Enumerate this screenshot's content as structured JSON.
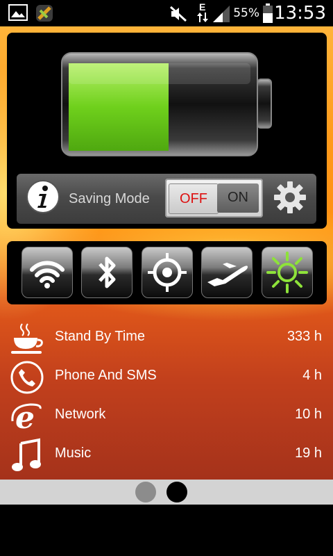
{
  "status_bar": {
    "battery_percent": "55%",
    "time": "13:53",
    "network_type": "E",
    "icons": [
      "gallery-icon",
      "app-icon",
      "mute-icon",
      "data-arrows-icon",
      "signal-icon",
      "battery-icon"
    ]
  },
  "battery": {
    "level": 0.55,
    "fill_color": "#7ee02a"
  },
  "saving_mode": {
    "label": "Saving Mode",
    "toggle_off": "OFF",
    "toggle_on": "ON",
    "state": "OFF"
  },
  "toggles": [
    {
      "name": "wifi",
      "active": false
    },
    {
      "name": "bluetooth",
      "active": false
    },
    {
      "name": "gps",
      "active": false
    },
    {
      "name": "airplane",
      "active": false
    },
    {
      "name": "brightness",
      "active": true
    }
  ],
  "usage": [
    {
      "icon": "coffee-cup-icon",
      "label": "Stand By Time",
      "value": "333 h"
    },
    {
      "icon": "phone-icon",
      "label": "Phone And SMS",
      "value": "4 h"
    },
    {
      "icon": "internet-explorer-icon",
      "label": "Network",
      "value": "10 h"
    },
    {
      "icon": "music-note-icon",
      "label": "Music",
      "value": "19 h"
    }
  ],
  "pager": {
    "pages": 2,
    "current": 2
  },
  "colors": {
    "accent_green": "#7ee02a",
    "toggle_off_red": "#dd1111"
  }
}
